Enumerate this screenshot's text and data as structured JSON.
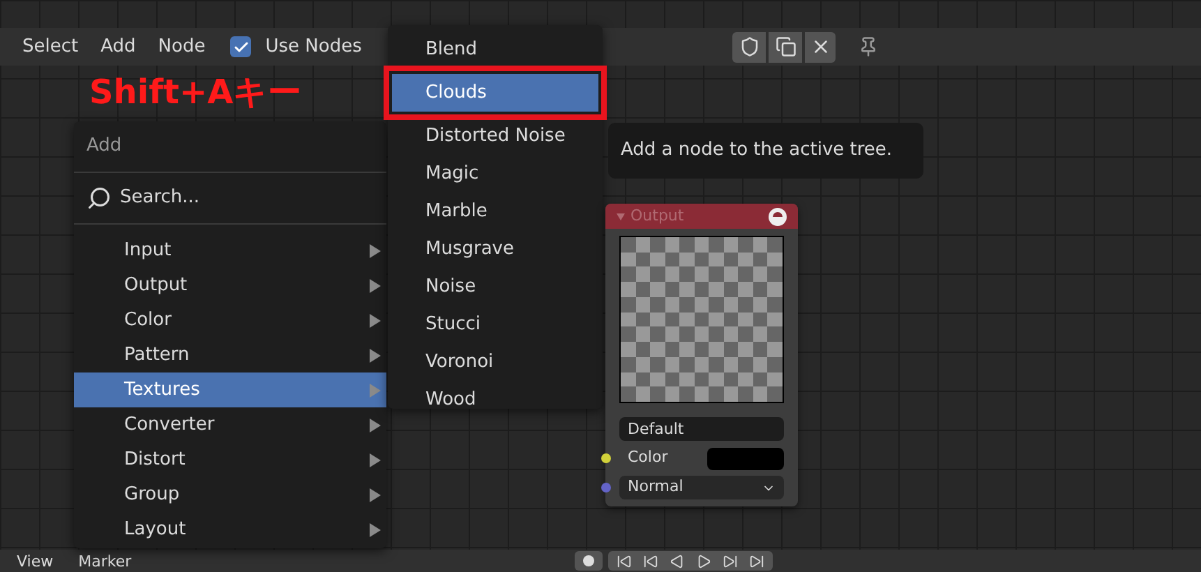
{
  "header": {
    "menus": [
      "Select",
      "Add",
      "Node"
    ],
    "use_nodes": {
      "label": "Use Nodes",
      "checked": true
    }
  },
  "annotation": {
    "text": "Shift+Aキー"
  },
  "add_menu": {
    "title": "Add",
    "search": "Search...",
    "items": [
      {
        "label": "Input",
        "selected": false
      },
      {
        "label": "Output",
        "selected": false
      },
      {
        "label": "Color",
        "selected": false
      },
      {
        "label": "Pattern",
        "selected": false
      },
      {
        "label": "Textures",
        "selected": true
      },
      {
        "label": "Converter",
        "selected": false
      },
      {
        "label": "Distort",
        "selected": false
      },
      {
        "label": "Group",
        "selected": false
      },
      {
        "label": "Layout",
        "selected": false
      }
    ]
  },
  "texture_menu": {
    "items": [
      {
        "label": "Blend",
        "selected": false
      },
      {
        "label": "Clouds",
        "selected": true
      },
      {
        "label": "Distorted Noise",
        "selected": false
      },
      {
        "label": "Magic",
        "selected": false
      },
      {
        "label": "Marble",
        "selected": false
      },
      {
        "label": "Musgrave",
        "selected": false
      },
      {
        "label": "Noise",
        "selected": false
      },
      {
        "label": "Stucci",
        "selected": false
      },
      {
        "label": "Voronoi",
        "selected": false
      },
      {
        "label": "Wood",
        "selected": false
      }
    ]
  },
  "tooltip": "Add a node to the active tree.",
  "node": {
    "title": "Output",
    "image_field": "Default",
    "inputs": [
      {
        "kind": "color",
        "label": "Color",
        "color": "#d1d13a"
      },
      {
        "kind": "dropdown",
        "label": "Normal",
        "color": "#6363c7"
      }
    ]
  },
  "bottom_bar": {
    "menus": [
      "View",
      "Marker"
    ]
  }
}
